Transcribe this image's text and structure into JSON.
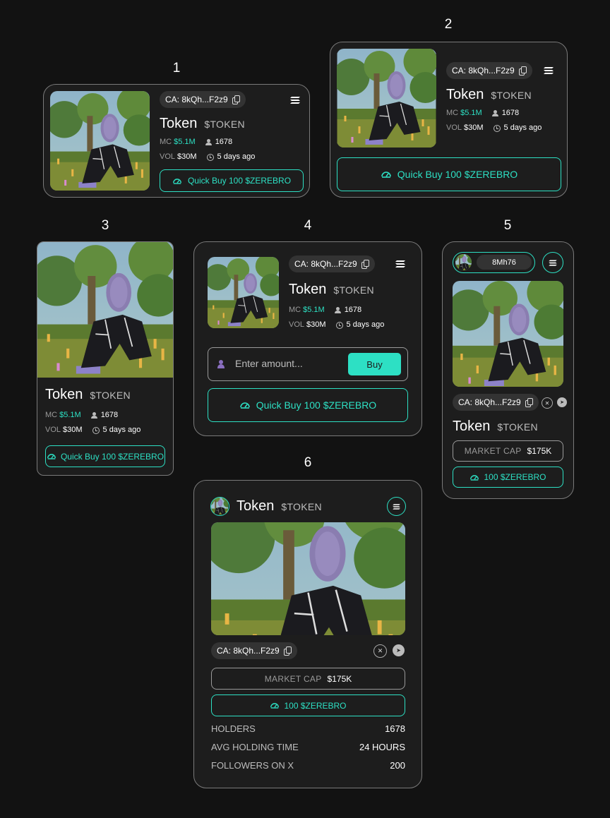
{
  "labels": {
    "v1": "1",
    "v2": "2",
    "v3": "3",
    "v4": "4",
    "v5": "5",
    "v6": "6"
  },
  "token": {
    "name": "Token",
    "ticker": "$TOKEN",
    "ca": "CA: 8kQh...F2z9",
    "mc_label": "MC",
    "mc_value": "$5.1M",
    "holders": "1678",
    "vol_label": "VOL",
    "vol_value": "$30M",
    "age": "5 days ago"
  },
  "quick_buy": "Quick Buy 100 $ZEREBRO",
  "short_buy": "100 $ZEREBRO",
  "amount": {
    "placeholder": "Enter amount...",
    "buy": "Buy"
  },
  "v5": {
    "pill": "8Mh76"
  },
  "market_cap": {
    "label": "MARKET CAP",
    "value": "$175K"
  },
  "stats": [
    {
      "label": "HOLDERS",
      "value": "1678"
    },
    {
      "label": "AVG HOLDING TIME",
      "value": "24 HOURS"
    },
    {
      "label": "FOLLOWERS ON X",
      "value": "200"
    }
  ],
  "colors": {
    "accent": "#2de0c4",
    "background": "#121212",
    "card": "#1d1d1d"
  }
}
